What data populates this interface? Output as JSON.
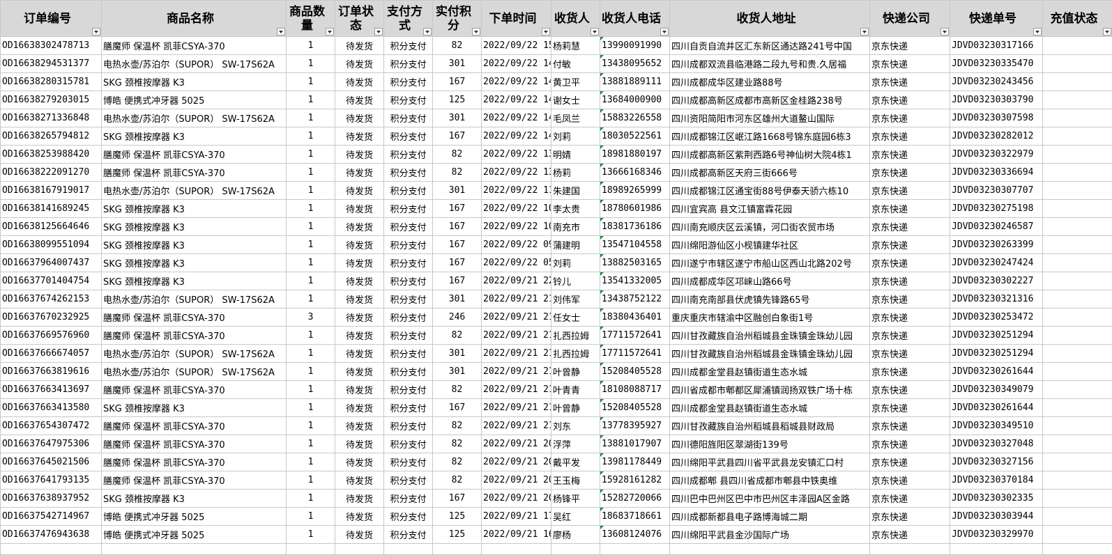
{
  "columns": [
    {
      "label": "订单编号"
    },
    {
      "label": "商品名称"
    },
    {
      "label": "商品数量"
    },
    {
      "label": "订单状态"
    },
    {
      "label": "支付方式"
    },
    {
      "label": "实付积分"
    },
    {
      "label": "下单时间"
    },
    {
      "label": "收货人"
    },
    {
      "label": "收货人电话"
    },
    {
      "label": "收货人地址"
    },
    {
      "label": "快递公司"
    },
    {
      "label": "快递单号"
    },
    {
      "label": "充值状态"
    }
  ],
  "rows": [
    [
      "OD16638302478713",
      "膳魔师 保温杯 凯菲CSYA-370",
      "1",
      "待发货",
      "积分支付",
      "82",
      "2022/09/22 15",
      "杨莉慧",
      "13990091990",
      "四川自贡自流井区汇东新区通达路241号中国",
      "京东快递",
      "JDVD03230317166",
      ""
    ],
    [
      "OD16638294531377",
      "电热水壶/苏泊尔（SUPOR） SW-17S62A",
      "1",
      "待发货",
      "积分支付",
      "301",
      "2022/09/22 14",
      "付敏",
      "13438095652",
      "四川成都双流县临港路二段九号和贵.久居福",
      "京东快递",
      "JDVD03230335470",
      ""
    ],
    [
      "OD16638280315781",
      "SKG 颈椎按摩器 K3",
      "1",
      "待发货",
      "积分支付",
      "167",
      "2022/09/22 14",
      "黄卫平",
      "13881889111",
      "四川成都成华区建业路88号",
      "京东快递",
      "JDVD03230243456",
      ""
    ],
    [
      "OD16638279203015",
      "博皓 便携式冲牙器 5025",
      "1",
      "待发货",
      "积分支付",
      "125",
      "2022/09/22 14",
      "谢女士",
      "13684000900",
      "四川成都高新区成都市高新区金桂路238号",
      "京东快递",
      "JDVD03230303790",
      ""
    ],
    [
      "OD16638271336848",
      "电热水壶/苏泊尔（SUPOR） SW-17S62A",
      "1",
      "待发货",
      "积分支付",
      "301",
      "2022/09/22 14",
      "毛凤兰",
      "15883226558",
      "四川资阳简阳市河东区雄州大道鳌山国际",
      "京东快递",
      "JDVD03230307598",
      ""
    ],
    [
      "OD16638265794812",
      "SKG 颈椎按摩器 K3",
      "1",
      "待发货",
      "积分支付",
      "167",
      "2022/09/22 14",
      "刘莉",
      "18030522561",
      "四川成都锦江区岷江路1668号锦东庭园6栋3",
      "京东快递",
      "JDVD03230282012",
      ""
    ],
    [
      "OD16638253988420",
      "膳魔师 保温杯 凯菲CSYA-370",
      "1",
      "待发货",
      "积分支付",
      "82",
      "2022/09/22 13",
      "明婧",
      "18981880197",
      "四川成都高新区紫荆西路6号神仙树大院4栋1",
      "京东快递",
      "JDVD03230322979",
      ""
    ],
    [
      "OD16638222091270",
      "膳魔师 保温杯 凯菲CSYA-370",
      "1",
      "待发货",
      "积分支付",
      "82",
      "2022/09/22 13",
      "杨莉",
      "13666168346",
      "四川成都高新区天府三街666号",
      "京东快递",
      "JDVD03230336694",
      ""
    ],
    [
      "OD16638167919017",
      "电热水壶/苏泊尔（SUPOR） SW-17S62A",
      "1",
      "待发货",
      "积分支付",
      "301",
      "2022/09/22 11",
      "朱建国",
      "18989265999",
      "四川成都锦江区通宝街88号伊泰天骄六栋10",
      "京东快递",
      "JDVD03230307707",
      ""
    ],
    [
      "OD16638141689245",
      "SKG 颈椎按摩器 K3",
      "1",
      "待发货",
      "积分支付",
      "167",
      "2022/09/22 10",
      "李太贵",
      "18780601986",
      "四川宜宾高  县文江镇富霖花园",
      "京东快递",
      "JDVD03230275198",
      ""
    ],
    [
      "OD16638125664646",
      "SKG 颈椎按摩器 K3",
      "1",
      "待发货",
      "积分支付",
      "167",
      "2022/09/22 10",
      "南充市",
      "18381736186",
      "四川南充顺庆区云溪镇，河口街农贸市场",
      "京东快递",
      "JDVD03230246587",
      ""
    ],
    [
      "OD16638099551094",
      "SKG 颈椎按摩器 K3",
      "1",
      "待发货",
      "积分支付",
      "167",
      "2022/09/22 09",
      "蒲建明",
      "13547104558",
      "四川绵阳游仙区小枧镇建华社区",
      "京东快递",
      "JDVD03230263399",
      ""
    ],
    [
      "OD16637964007437",
      "SKG 颈椎按摩器 K3",
      "1",
      "待发货",
      "积分支付",
      "167",
      "2022/09/22 05",
      "刘莉",
      "13882503165",
      "四川遂宁市辖区遂宁市船山区西山北路202号",
      "京东快递",
      "JDVD03230247424",
      ""
    ],
    [
      "OD16637701404754",
      "SKG 颈椎按摩器 K3",
      "1",
      "待发货",
      "积分支付",
      "167",
      "2022/09/21 22",
      "铃儿",
      "13541332005",
      "四川成都成华区邛崃山路66号",
      "京东快递",
      "JDVD03230302227",
      ""
    ],
    [
      "OD16637674262153",
      "电热水壶/苏泊尔（SUPOR） SW-17S62A",
      "1",
      "待发货",
      "积分支付",
      "301",
      "2022/09/21 21",
      "刘伟军",
      "13438752122",
      "四川南充南部县伏虎镇先锋路65号",
      "京东快递",
      "JDVD03230321316",
      ""
    ],
    [
      "OD16637670232925",
      "膳魔师 保温杯 凯菲CSYA-370",
      "3",
      "待发货",
      "积分支付",
      "246",
      "2022/09/21 21",
      "任女士",
      "18380436401",
      "重庆重庆市辖渝中区融创白象街1号",
      "京东快递",
      "JDVD03230253472",
      ""
    ],
    [
      "OD16637669576960",
      "膳魔师 保温杯 凯菲CSYA-370",
      "1",
      "待发货",
      "积分支付",
      "82",
      "2022/09/21 21",
      "扎西拉姆",
      "17711572641",
      "四川甘孜藏族自治州稻城县金珠镇金珠幼儿园",
      "京东快递",
      "JDVD03230251294",
      ""
    ],
    [
      "OD16637666674057",
      "电热水壶/苏泊尔（SUPOR） SW-17S62A",
      "1",
      "待发货",
      "积分支付",
      "301",
      "2022/09/21 21",
      "扎西拉姆",
      "17711572641",
      "四川甘孜藏族自治州稻城县金珠镇金珠幼儿园",
      "京东快递",
      "JDVD03230251294",
      ""
    ],
    [
      "OD16637663819616",
      "电热水壶/苏泊尔（SUPOR） SW-17S62A",
      "1",
      "待发货",
      "积分支付",
      "301",
      "2022/09/21 21",
      "叶曾静",
      "15208405528",
      "四川成都金堂县赵镇街道生态水城",
      "京东快递",
      "JDVD03230261644",
      ""
    ],
    [
      "OD16637663413697",
      "膳魔师 保温杯 凯菲CSYA-370",
      "1",
      "待发货",
      "积分支付",
      "82",
      "2022/09/21 21",
      "叶青青",
      "18108088717",
      "四川省成都市郫都区犀浦镇润扬双铁广场十栋",
      "京东快递",
      "JDVD03230349079",
      ""
    ],
    [
      "OD16637663413580",
      "SKG 颈椎按摩器 K3",
      "1",
      "待发货",
      "积分支付",
      "167",
      "2022/09/21 21",
      "叶曾静",
      "15208405528",
      "四川成都金堂县赵镇街道生态水城",
      "京东快递",
      "JDVD03230261644",
      ""
    ],
    [
      "OD16637654307472",
      "膳魔师 保温杯 凯菲CSYA-370",
      "1",
      "待发货",
      "积分支付",
      "82",
      "2022/09/21 21",
      "刘东",
      "13778395927",
      "四川甘孜藏族自治州稻城县稻城县财政局",
      "京东快递",
      "JDVD03230349510",
      ""
    ],
    [
      "OD16637647975306",
      "膳魔师 保温杯 凯菲CSYA-370",
      "1",
      "待发货",
      "积分支付",
      "82",
      "2022/09/21 20",
      "浮萍",
      "13881017907",
      "四川德阳旌阳区翠湖街139号",
      "京东快递",
      "JDVD03230327048",
      ""
    ],
    [
      "OD16637645021506",
      "膳魔师 保温杯 凯菲CSYA-370",
      "1",
      "待发货",
      "积分支付",
      "82",
      "2022/09/21 20",
      "戴平发",
      "13981178449",
      "四川绵阳平武县四川省平武县龙安镇汇口村",
      "京东快递",
      "JDVD03230327156",
      ""
    ],
    [
      "OD16637641793135",
      "膳魔师 保温杯 凯菲CSYA-370",
      "1",
      "待发货",
      "积分支付",
      "82",
      "2022/09/21 20",
      "王玉梅",
      "15928161282",
      "四川成都郫  县四川省成都市郫县中铁奥维",
      "京东快递",
      "JDVD03230370184",
      ""
    ],
    [
      "OD16637638937952",
      "SKG 颈椎按摩器 K3",
      "1",
      "待发货",
      "积分支付",
      "167",
      "2022/09/21 20",
      "杨锋平",
      "15282720066",
      "四川巴中巴州区巴中市巴州区丰泽园A区金路",
      "京东快递",
      "JDVD03230302335",
      ""
    ],
    [
      "OD16637542714967",
      "博皓 便携式冲牙器 5025",
      "1",
      "待发货",
      "积分支付",
      "125",
      "2022/09/21 17",
      "吴红",
      "18683718661",
      "四川成都新都县电子路博海城二期",
      "京东快递",
      "JDVD03230303944",
      ""
    ],
    [
      "OD16637476943638",
      "博皓 便携式冲牙器 5025",
      "1",
      "待发货",
      "积分支付",
      "125",
      "2022/09/21 16",
      "廖杨",
      "13608124076",
      "四川绵阳平武县金沙国际广场",
      "京东快递",
      "JDVD03230329970",
      ""
    ]
  ]
}
